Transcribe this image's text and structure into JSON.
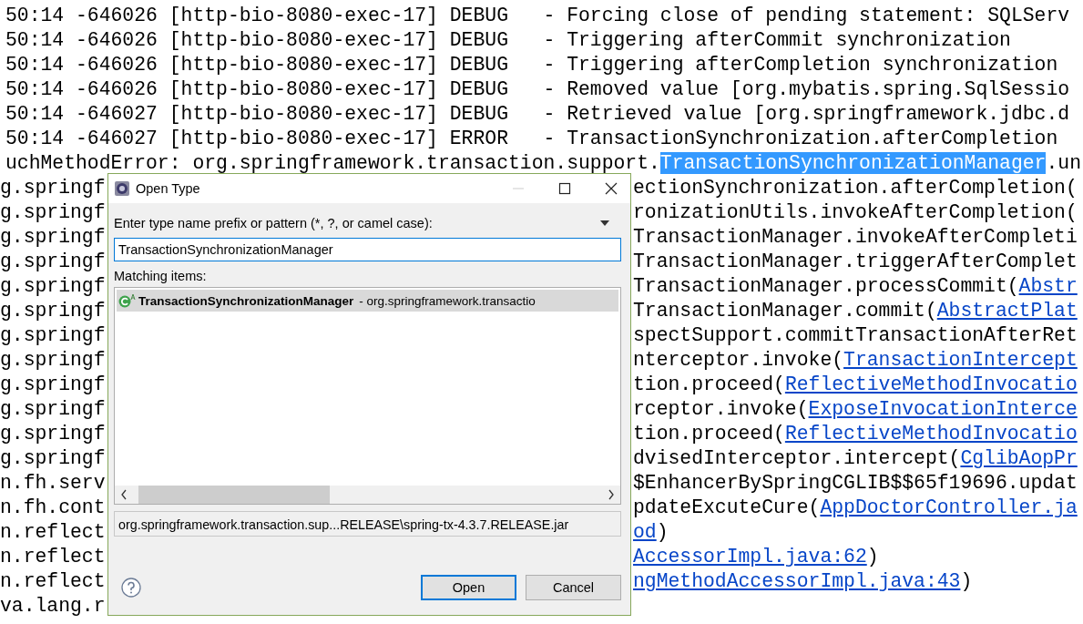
{
  "console": {
    "lines": [
      {
        "segments": [
          {
            "kind": "text",
            "text": "50:14 -646026 [http-bio-8080-exec-17] DEBUG   - Forcing close of pending statement: SQLServ"
          }
        ]
      },
      {
        "segments": [
          {
            "kind": "text",
            "text": "50:14 -646026 [http-bio-8080-exec-17] DEBUG   - Triggering afterCommit synchronization"
          }
        ]
      },
      {
        "segments": [
          {
            "kind": "text",
            "text": "50:14 -646026 [http-bio-8080-exec-17] DEBUG   - Triggering afterCompletion synchronization"
          }
        ]
      },
      {
        "segments": [
          {
            "kind": "text",
            "text": "50:14 -646026 [http-bio-8080-exec-17] DEBUG   - Removed value [org.mybatis.spring.SqlSessio"
          }
        ]
      },
      {
        "segments": [
          {
            "kind": "text",
            "text": "50:14 -646027 [http-bio-8080-exec-17] DEBUG   - Retrieved value [org.springframework.jdbc.d"
          }
        ]
      },
      {
        "segments": [
          {
            "kind": "text",
            "text": "50:14 -646027 [http-bio-8080-exec-17] ERROR   - TransactionSynchronization.afterCompletion"
          }
        ]
      },
      {
        "segments": [
          {
            "kind": "text",
            "text": "uchMethodError: org.springframework.transaction.support."
          },
          {
            "kind": "selection",
            "text": "TransactionSynchronizationManager"
          },
          {
            "kind": "text",
            "text": ".un"
          }
        ]
      }
    ],
    "trace": [
      {
        "left": "g.springf",
        "right": [
          {
            "kind": "text",
            "text": "ectionSynchronization.afterCompletion("
          }
        ]
      },
      {
        "left": "g.springf",
        "right": [
          {
            "kind": "text",
            "text": "ronizationUtils.invokeAfterCompletion("
          }
        ]
      },
      {
        "left": "g.springf",
        "right": [
          {
            "kind": "text",
            "text": "TransactionManager.invokeAfterCompleti"
          }
        ]
      },
      {
        "left": "g.springf",
        "right": [
          {
            "kind": "text",
            "text": "TransactionManager.triggerAfterComplet"
          }
        ]
      },
      {
        "left": "g.springf",
        "right": [
          {
            "kind": "text",
            "text": "TransactionManager.processCommit("
          },
          {
            "kind": "link",
            "text": "Abstr"
          }
        ]
      },
      {
        "left": "g.springf",
        "right": [
          {
            "kind": "text",
            "text": "TransactionManager.commit("
          },
          {
            "kind": "link",
            "text": "AbstractPlat"
          }
        ]
      },
      {
        "left": "g.springf",
        "right": [
          {
            "kind": "text",
            "text": "spectSupport.commitTransactionAfterRet"
          }
        ]
      },
      {
        "left": "g.springf",
        "right": [
          {
            "kind": "text",
            "text": "nterceptor.invoke("
          },
          {
            "kind": "link",
            "text": "TransactionIntercept"
          }
        ]
      },
      {
        "left": "g.springf",
        "right": [
          {
            "kind": "text",
            "text": "tion.proceed("
          },
          {
            "kind": "link",
            "text": "ReflectiveMethodInvocatio"
          }
        ]
      },
      {
        "left": "g.springf",
        "right": [
          {
            "kind": "text",
            "text": "rceptor.invoke("
          },
          {
            "kind": "link",
            "text": "ExposeInvocationInterce"
          }
        ]
      },
      {
        "left": "g.springf",
        "right": [
          {
            "kind": "text",
            "text": "tion.proceed("
          },
          {
            "kind": "link",
            "text": "ReflectiveMethodInvocatio"
          }
        ]
      },
      {
        "left": "g.springf",
        "right": [
          {
            "kind": "text",
            "text": "dvisedInterceptor.intercept("
          },
          {
            "kind": "link",
            "text": "CglibAopPr"
          }
        ]
      },
      {
        "left": "n.fh.serv",
        "right": [
          {
            "kind": "text",
            "text": "$EnhancerBySpringCGLIB$$65f19696.updat"
          }
        ]
      },
      {
        "left": "n.fh.cont",
        "right": [
          {
            "kind": "text",
            "text": "pdateExcuteCure("
          },
          {
            "kind": "link",
            "text": "AppDoctorController.ja"
          }
        ]
      },
      {
        "left": "n.reflect",
        "right": [
          {
            "kind": "link",
            "text": "od"
          },
          {
            "kind": "text",
            "text": ")"
          }
        ]
      },
      {
        "left": "n.reflect",
        "right": [
          {
            "kind": "link",
            "text": "AccessorImpl.java:62"
          },
          {
            "kind": "text",
            "text": ")"
          }
        ]
      },
      {
        "left": "n.reflect",
        "right": [
          {
            "kind": "link",
            "text": "ngMethodAccessorImpl.java:43"
          },
          {
            "kind": "text",
            "text": ")"
          }
        ]
      },
      {
        "left": "va.lang.r"
      }
    ]
  },
  "dialog": {
    "title": "Open Type",
    "prompt": "Enter type name prefix or pattern (*, ?, or camel case):",
    "pattern": "TransactionSynchronizationManager",
    "matching_label": "Matching items:",
    "items": [
      {
        "name": "TransactionSynchronizationManager",
        "package": "- org.springframework.transactio",
        "selected": true
      }
    ],
    "location": "org.springframework.transaction.sup...RELEASE\\spring-tx-4.3.7.RELEASE.jar",
    "buttons": [
      {
        "label": "Open",
        "default": true
      },
      {
        "label": "Cancel",
        "default": false
      }
    ]
  }
}
